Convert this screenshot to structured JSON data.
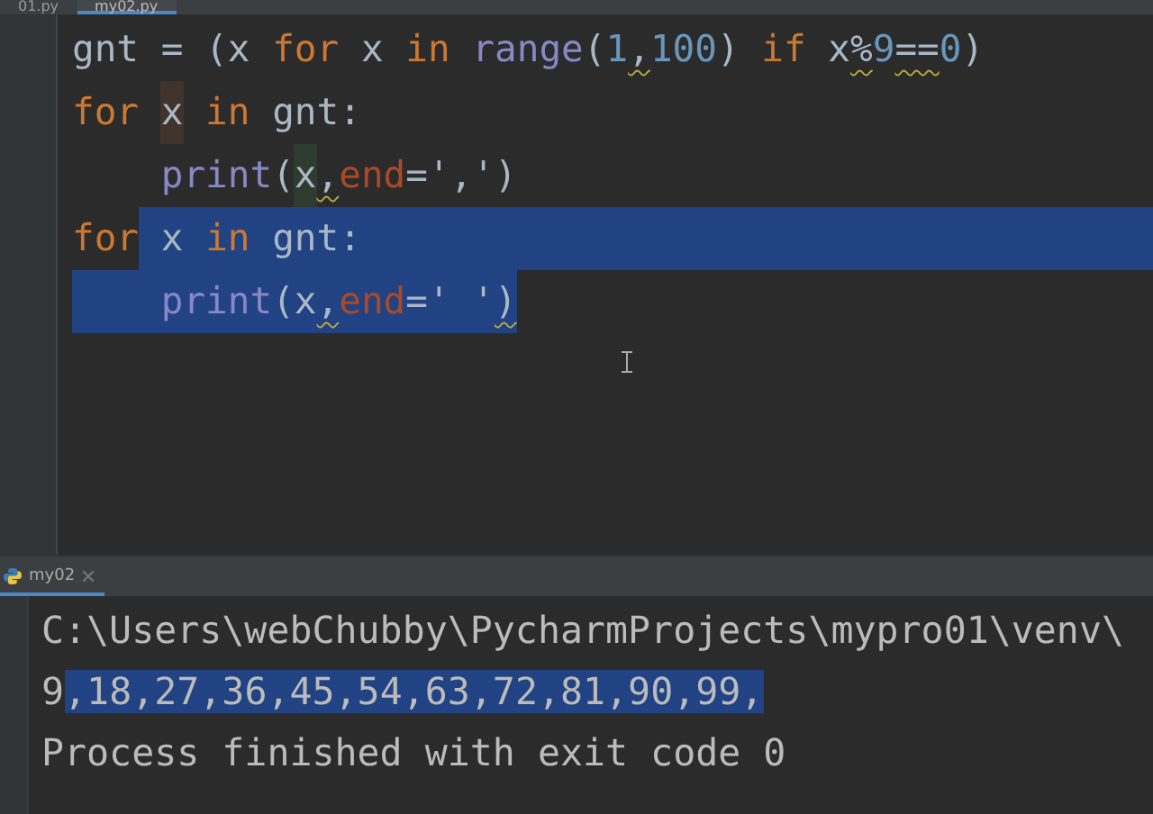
{
  "editor_tabs": [
    {
      "label": "01.py",
      "selected": false
    },
    {
      "label": "my02.py",
      "selected": true
    }
  ],
  "code_lines": [
    {
      "indented": false,
      "selection_to_edge": false,
      "tokens": [
        {
          "text": "gnt = (x ",
          "kind": "plain",
          "selected": false,
          "warning": false
        },
        {
          "text": "for",
          "kind": "keyword",
          "selected": false,
          "warning": false
        },
        {
          "text": " x ",
          "kind": "plain",
          "selected": false,
          "warning": false
        },
        {
          "text": "in",
          "kind": "keyword",
          "selected": false,
          "warning": false
        },
        {
          "text": " range",
          "kind": "builtin",
          "selected": false,
          "warning": false
        },
        {
          "text": "(",
          "kind": "plain",
          "selected": false,
          "warning": false
        },
        {
          "text": "1",
          "kind": "number",
          "selected": false,
          "warning": false
        },
        {
          "text": ",",
          "kind": "plain",
          "selected": false,
          "warning": true
        },
        {
          "text": "100",
          "kind": "number",
          "selected": false,
          "warning": false
        },
        {
          "text": ") ",
          "kind": "plain",
          "selected": false,
          "warning": false
        },
        {
          "text": "if",
          "kind": "keyword",
          "selected": false,
          "warning": false
        },
        {
          "text": " x",
          "kind": "plain",
          "selected": false,
          "warning": false
        },
        {
          "text": "%",
          "kind": "plain",
          "selected": false,
          "warning": true
        },
        {
          "text": "9",
          "kind": "number",
          "selected": false,
          "warning": false
        },
        {
          "text": "==",
          "kind": "plain",
          "selected": false,
          "warning": true
        },
        {
          "text": "0",
          "kind": "number",
          "selected": false,
          "warning": false
        },
        {
          "text": ")",
          "kind": "plain",
          "selected": false,
          "warning": false
        }
      ]
    },
    {
      "indented": false,
      "selection_to_edge": false,
      "tokens": [
        {
          "text": "for ",
          "kind": "keyword",
          "selected": false,
          "warning": false
        },
        {
          "text": "x",
          "kind": "write_usage",
          "selected": false,
          "warning": false
        },
        {
          "text": " in",
          "kind": "keyword",
          "selected": false,
          "warning": false
        },
        {
          "text": " gnt:",
          "kind": "plain",
          "selected": false,
          "warning": false
        }
      ]
    },
    {
      "indented": true,
      "selection_to_edge": false,
      "tokens": [
        {
          "text": "print",
          "kind": "builtin",
          "selected": false,
          "warning": false
        },
        {
          "text": "(",
          "kind": "plain",
          "selected": false,
          "warning": false
        },
        {
          "text": "x",
          "kind": "read_usage",
          "selected": false,
          "warning": false
        },
        {
          "text": ",",
          "kind": "plain",
          "selected": false,
          "warning": true
        },
        {
          "text": "end",
          "kind": "param",
          "selected": false,
          "warning": false
        },
        {
          "text": "=',')",
          "kind": "plain",
          "selected": false,
          "warning": false
        }
      ]
    },
    {
      "indented": false,
      "selection_to_edge": true,
      "tokens": [
        {
          "text": "for",
          "kind": "keyword",
          "selected": false,
          "warning": false
        },
        {
          "text": " x ",
          "kind": "plain",
          "selected": true,
          "warning": false
        },
        {
          "text": "in",
          "kind": "keyword",
          "selected": true,
          "warning": false
        },
        {
          "text": " gnt:",
          "kind": "plain",
          "selected": true,
          "warning": false
        }
      ]
    },
    {
      "indented": true,
      "selection_to_edge": false,
      "tokens": [
        {
          "text": "print",
          "kind": "builtin",
          "selected": true,
          "warning": false
        },
        {
          "text": "(x",
          "kind": "plain",
          "selected": true,
          "warning": false
        },
        {
          "text": ",",
          "kind": "plain",
          "selected": true,
          "warning": true
        },
        {
          "text": "end",
          "kind": "param",
          "selected": true,
          "warning": false
        },
        {
          "text": "=' '",
          "kind": "plain",
          "selected": true,
          "warning": false
        },
        {
          "text": ")",
          "kind": "plain",
          "selected": true,
          "warning": true
        }
      ]
    }
  ],
  "run_tab": {
    "label": "my02",
    "selected": true
  },
  "output_lines": [
    {
      "tokens": [
        {
          "text": "C:\\Users\\webChubby\\PycharmProjects\\mypro01\\venv\\",
          "selected": false
        }
      ]
    },
    {
      "tokens": [
        {
          "text": "9",
          "selected": false
        },
        {
          "text": ",18,27,36,45,54,63,72,81,90,99,",
          "selected": true
        }
      ]
    },
    {
      "tokens": [
        {
          "text": "Process finished with exit code 0",
          "selected": false
        }
      ]
    }
  ]
}
